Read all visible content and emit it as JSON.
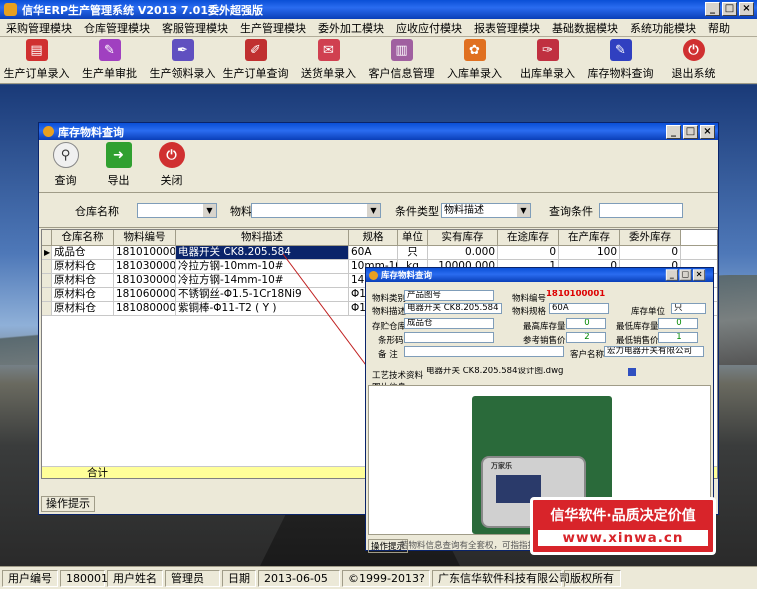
{
  "app": {
    "title": "信华ERP生产管理系统  V2013  7.01委外超强版"
  },
  "window_buttons": [
    "_",
    "□",
    "×"
  ],
  "menu": [
    "采购管理模块",
    "仓库管理模块",
    "客服管理模块",
    "生产管理模块",
    "委外加工模块",
    "应收应付模块",
    "报表管理模块",
    "基础数据模块",
    "系统功能模块",
    "帮助"
  ],
  "toolbar": [
    {
      "label": "生产订单录入",
      "icon": "document-icon",
      "color": "#d03030"
    },
    {
      "label": "生产单审批",
      "icon": "feather-icon",
      "color": "#a040c0"
    },
    {
      "label": "生产领料录入",
      "icon": "pen-icon",
      "color": "#6050c0"
    },
    {
      "label": "生产订单查询",
      "icon": "brush-icon",
      "color": "#c03030"
    },
    {
      "label": "送货单录入",
      "icon": "paper-icon",
      "color": "#d04050"
    },
    {
      "label": "客户信息管理",
      "icon": "book-icon",
      "color": "#a060a0"
    },
    {
      "label": "入库单录入",
      "icon": "flower-icon",
      "color": "#e07020"
    },
    {
      "label": "出库单录入",
      "icon": "quill-icon",
      "color": "#c03040"
    },
    {
      "label": "库存物料查询",
      "icon": "feather-blue-icon",
      "color": "#3040c0"
    },
    {
      "label": "退出系统",
      "icon": "power-icon",
      "color": "#d03030"
    }
  ],
  "inner_window": {
    "title": "库存物料查询",
    "tools": [
      {
        "label": "查询",
        "icon": "magnifier-icon",
        "color": "#f0f0f0"
      },
      {
        "label": "导出",
        "icon": "green-arrow-icon",
        "color": "#30a030"
      },
      {
        "label": "关闭",
        "icon": "power-icon",
        "color": "#d03030"
      }
    ],
    "filters": {
      "warehouse_label": "仓库名称",
      "warehouse_value": "",
      "category_label": "物料类别",
      "category_value": "",
      "condtype_label": "条件类型",
      "condtype_value": "物料描述",
      "cond_label": "查询条件",
      "cond_value": ""
    },
    "columns": [
      "仓库名称",
      "物料编号",
      "物料描述",
      "规格",
      "单位",
      "实有库存",
      "在途库存",
      "在产库存",
      "委外库存"
    ],
    "rows": [
      [
        "成品仓",
        "1810100001",
        "电器开关 CK8.205.584",
        "60A",
        "只",
        "0.000",
        "0",
        "100",
        "0"
      ],
      [
        "原材料仓",
        "1810300001",
        "冷拉方钢-10mm-10#",
        "10mm-10#",
        "kg",
        "10000.000",
        "1",
        "0",
        "0"
      ],
      [
        "原材料仓",
        "1810300002",
        "冷拉方钢-14mm-10#",
        "14mm-10#",
        "",
        "",
        "",
        "",
        ""
      ],
      [
        "原材料仓",
        "1810600001",
        "不锈钢丝-Φ1.5-1Cr18Ni9",
        "Φ1.5",
        "",
        "",
        "",
        "",
        ""
      ],
      [
        "原材料仓",
        "1810800001",
        "紫铜棒-Φ11-T2 ( Y )",
        "Φ11",
        "",
        "",
        "",
        "",
        ""
      ]
    ],
    "total_label": "合计",
    "hint_label": "操作提示"
  },
  "popup": {
    "title": "库存物料查询",
    "fields": {
      "cat_label": "物料类别",
      "cat_value": "产品图号",
      "code_label": "物料编号",
      "code_value": "1810100001",
      "desc_label": "物料描述",
      "desc_value": "电器开关 CK8.205.584",
      "spec_label": "物料规格",
      "spec_value": "60A",
      "unit_label": "库存单位",
      "unit_value": "只",
      "wh_label": "存贮仓库",
      "wh_value": "成品仓",
      "maxs_label": "最高库存量",
      "maxs_value": "0",
      "mins_label": "最低库存量",
      "mins_value": "0",
      "barcode_label": "条形码",
      "barcode_value": "",
      "ref_label": "参考销售价",
      "ref_value": "2",
      "minp_label": "最低销售价",
      "minp_value": "1",
      "note_label": "备 注",
      "note_value": "",
      "cust_label": "客户名称",
      "cust_value": "宏力电器开关有限公司",
      "tech_label": "工艺技术资料",
      "tech_value": "电器开关 CK8.205.584设计图.dwg",
      "img_label": "图片信息",
      "device_brand": "万家乐",
      "hint_label": "操作提示",
      "hint_value": "若物料信息查询有全套权，可指指技术文件"
    }
  },
  "promo": {
    "line1": "信华软件·品质决定价值",
    "line2": "www.xinwa.cn"
  },
  "status": {
    "user_id_label": "用户编号",
    "user_id": "180001",
    "user_name_label": "用户姓名",
    "user_name": "管理员",
    "date_label": "日期",
    "date": "2013-06-05",
    "copyright": "©1999-2013?",
    "company": "广东信华软件科技有限公司",
    "rights": "版权所有"
  }
}
